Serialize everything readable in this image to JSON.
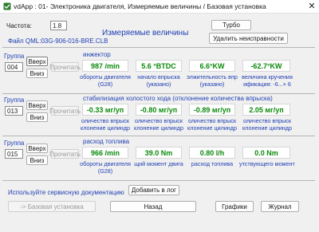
{
  "window": {
    "title": "vdApp : 01- Электроника двигателя,  Измеряемые величины / Базовая установка",
    "close_glyph": "✕"
  },
  "header": {
    "frequency_label": "Частота:",
    "frequency_value": "1.8",
    "turbo_label": "Турбо",
    "title": "Измеряемые величины",
    "file_label": "Файл QML:03G-906-016-BRE.CLB",
    "clear_faults_label": "Удалить неисправности"
  },
  "groups": [
    {
      "group_label": "Группа",
      "number": "004",
      "up_label": "Вверх",
      "down_label": "Вниз",
      "read_label": "Прочитать",
      "section_title": "инжектор",
      "values": [
        "987 /min",
        "5.6 °BTDC",
        "6.6°KW",
        "-62.7°KW"
      ],
      "captions": [
        [
          "обороты двигателя",
          "(G28)"
        ],
        [
          "начало впрыска",
          "(указано)"
        ],
        [
          "элжительность впр",
          "(указано)"
        ],
        [
          "величина кручения",
          "ификация: -6...+ 6"
        ]
      ]
    },
    {
      "group_label": "Группа",
      "number": "013",
      "up_label": "Вверх",
      "down_label": "Вниз",
      "read_label": "Прочитать",
      "section_title": "стабилизация холостого хода (отклонение количества впрыска)",
      "values": [
        "-0.33 мг/уп",
        "-0.80 мг/уп",
        "-0.89 мг/уп",
        "2.05 мг/уп"
      ],
      "captions": [
        [
          "оличество впрыск",
          "клонение цилиндр"
        ],
        [
          "оличество впрыск",
          "клонение цилиндр"
        ],
        [
          "оличество впрыск",
          "клонение цилиндр"
        ],
        [
          "оличество впрыск",
          "клонение цилиндр"
        ]
      ]
    },
    {
      "group_label": "Группа",
      "number": "015",
      "up_label": "Вверх",
      "down_label": "Вниз",
      "read_label": "Прочитать",
      "section_title": "расход топлива",
      "values": [
        "966 /min",
        "39.0 Nm",
        "0.80 l/h",
        "0.0 Nm"
      ],
      "captions": [
        [
          "обороты двигателя",
          "(G28)"
        ],
        [
          "щий момент двига",
          ""
        ],
        [
          "расход топлива",
          ""
        ],
        [
          "утствующего момента",
          ""
        ]
      ]
    }
  ],
  "footer": {
    "service_doc_label": "Используйте сервисную документацию",
    "add_log_label": "Добавить в лог",
    "basic_setting_label": "-> Базовая установка",
    "back_label": "Назад",
    "graphs_label": "Графики",
    "journal_label": "Журнал"
  },
  "colors": {
    "value_text": "#0a8a0a",
    "label_blue": "#1f3fb2",
    "window_bg": "#f0f0f0"
  }
}
